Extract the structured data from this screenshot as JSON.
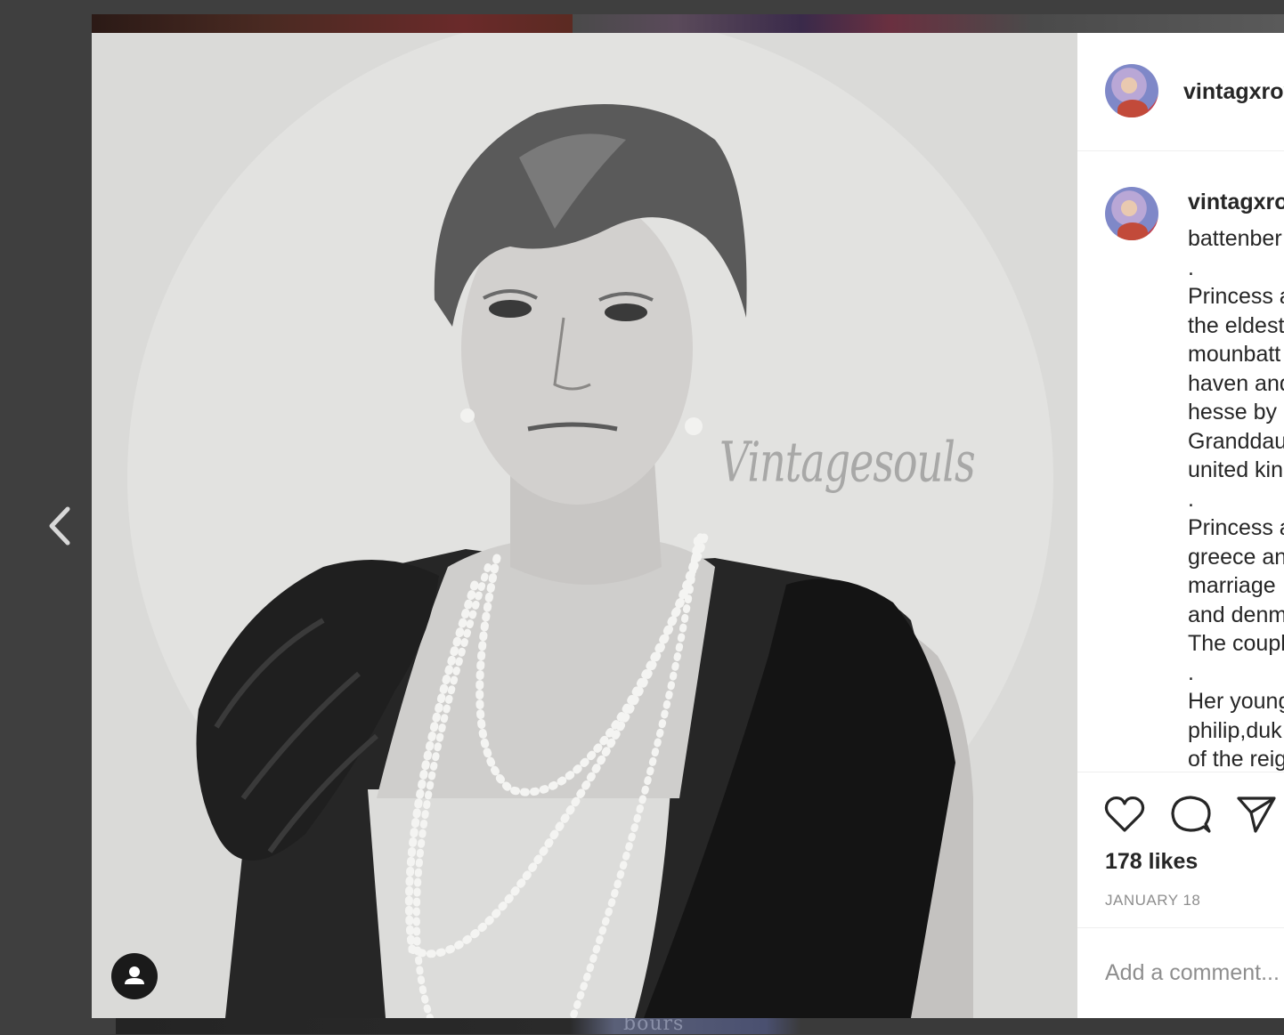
{
  "post": {
    "username": "vintagxroy",
    "watermark": "Vintagesouls",
    "caption_first_word": "vintagxro",
    "caption_lines": [
      "battenber",
      ".",
      "Princess a",
      "the eldest",
      "mounbatt",
      "haven and",
      "hesse by r",
      "Granddau",
      "united kin",
      ".",
      "Princess a",
      "greece an",
      "marriage",
      "and denm",
      "The coupl",
      ".",
      "Her young",
      "philip,duk",
      "of the reig"
    ],
    "likes": "178 likes",
    "date": "JANUARY 18"
  },
  "comment": {
    "placeholder": "Add a comment..."
  },
  "feed_behind": {
    "visible_text": "bours"
  },
  "icons": [
    "chevron-left-icon",
    "heart-icon",
    "comment-icon",
    "share-icon",
    "user-tag-icon"
  ],
  "colors": {
    "text": "#262626",
    "muted": "#8e8e8e",
    "panel": "#ffffff",
    "overlay": "#3f3f3f"
  }
}
